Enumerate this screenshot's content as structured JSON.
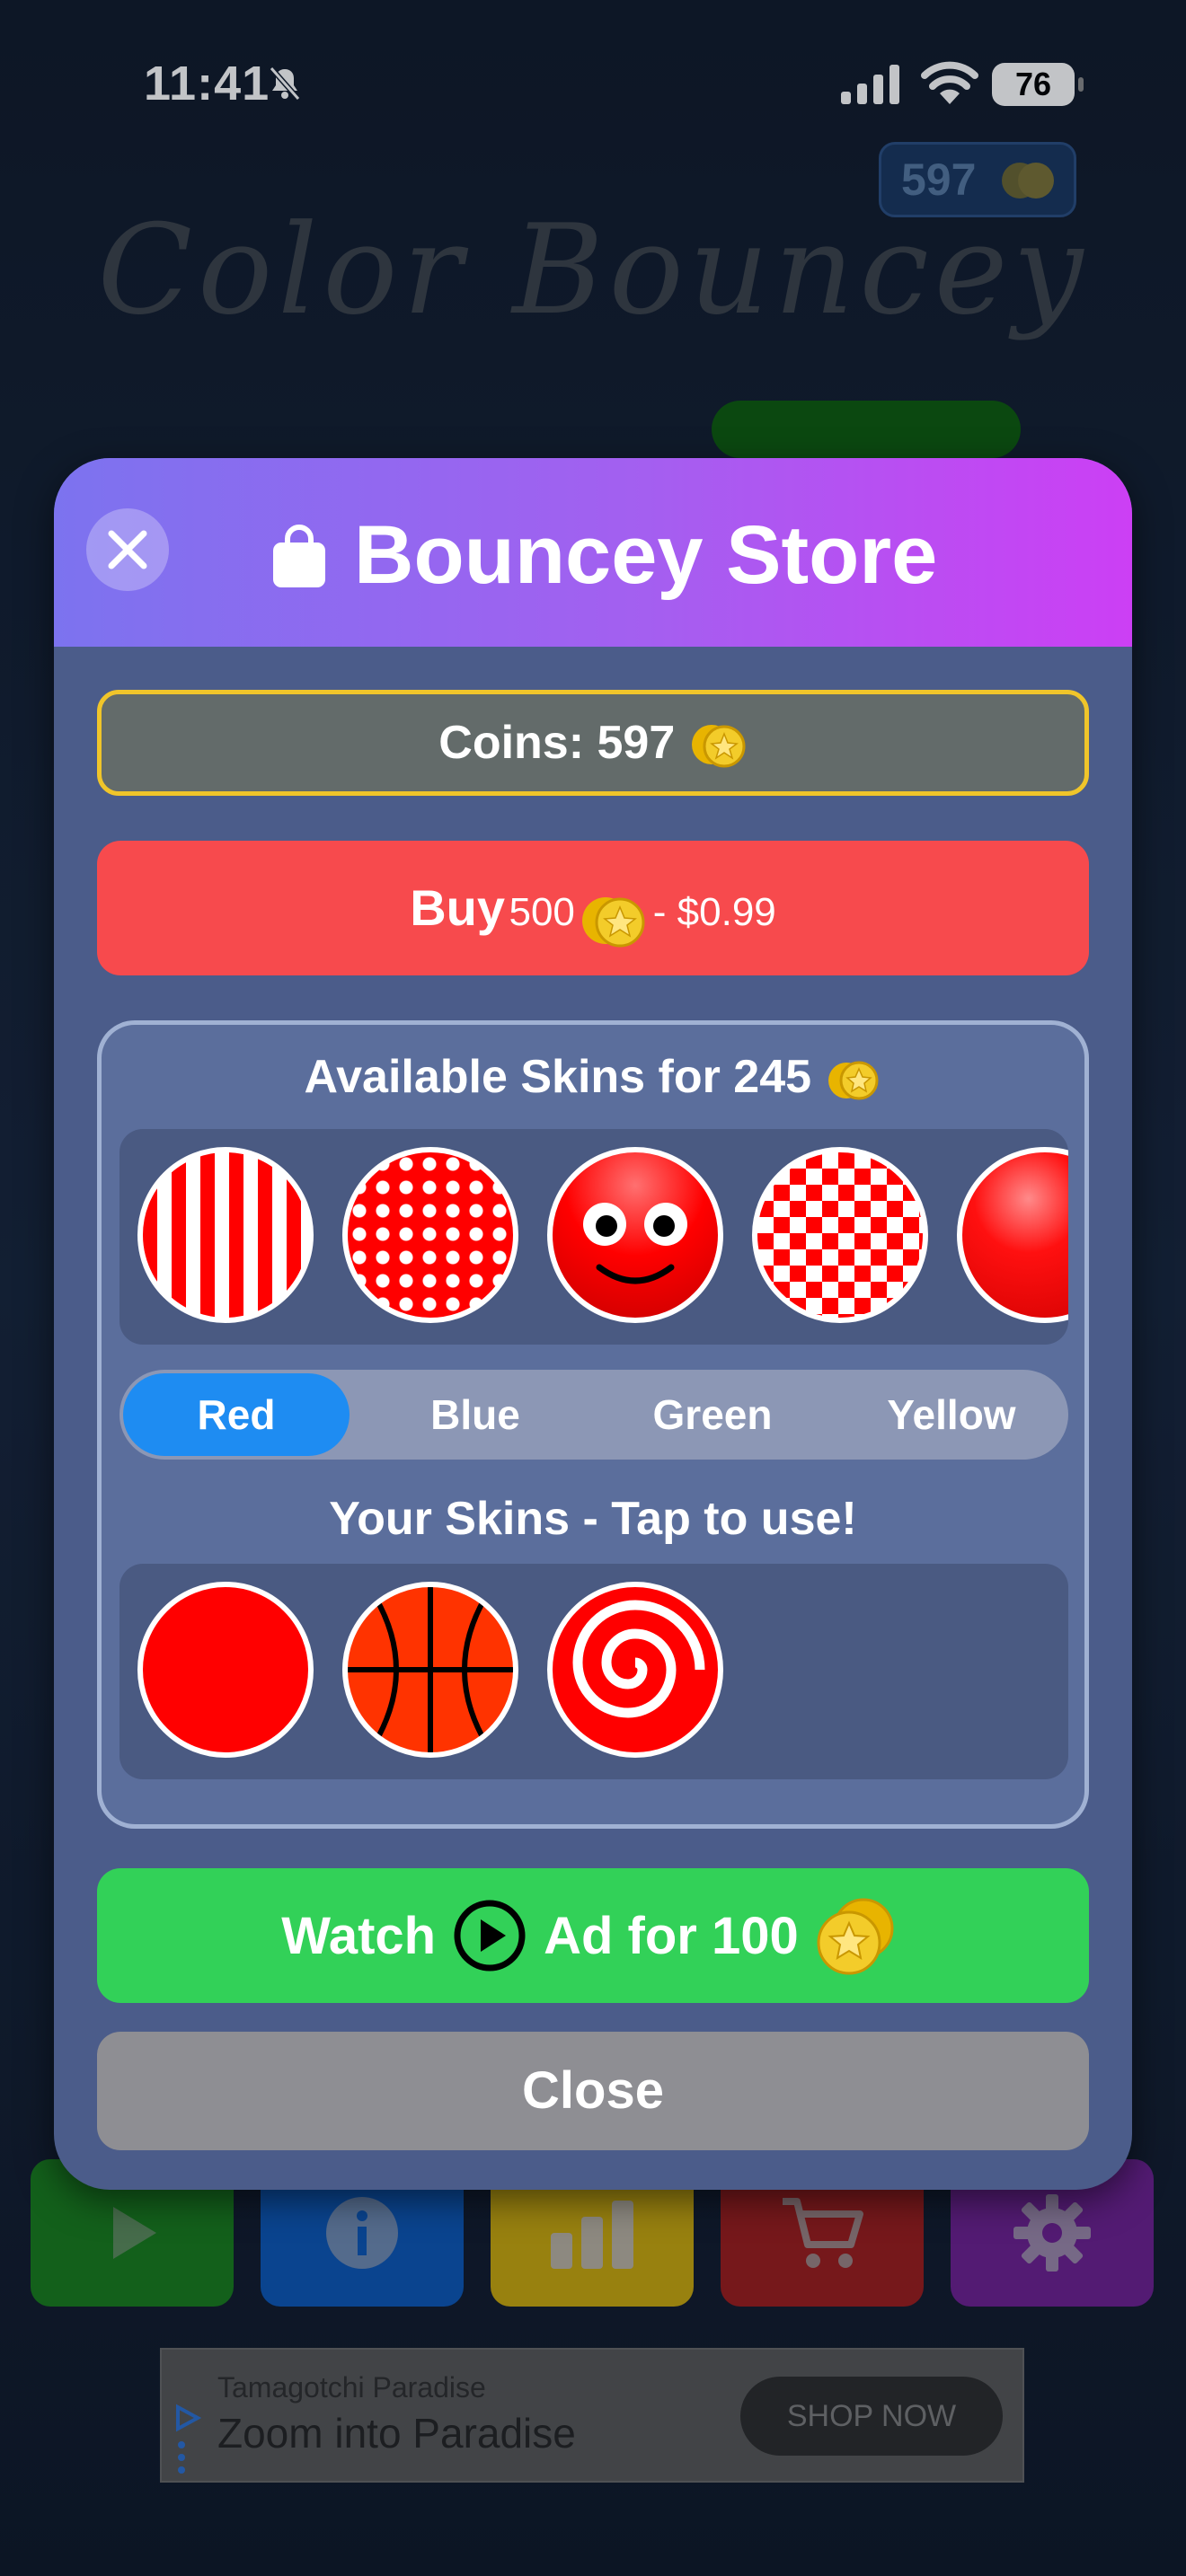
{
  "status_bar": {
    "time": "11:41",
    "battery": "76"
  },
  "game": {
    "coin_badge": "597",
    "title": "Color Bouncey"
  },
  "bottom_bar": {
    "buttons": [
      "play-icon",
      "info-icon",
      "stats-icon",
      "cart-icon",
      "gear-icon"
    ],
    "colors": [
      "#167a1a",
      "#0a55b5",
      "#c7a60a",
      "#9a1a1a",
      "#6b1e8f"
    ]
  },
  "ad": {
    "advertiser": "Tamagotchi Paradise",
    "headline": "Zoom into Paradise",
    "cta": "SHOP NOW"
  },
  "store": {
    "title": "Bouncey Store",
    "coins_label": "Coins: 597",
    "buy": {
      "main": "Buy",
      "sub": "500",
      "price": "- $0.99"
    },
    "available_title": "Available Skins for 245",
    "available_skins": [
      "stripes-red",
      "polka-dots-red",
      "smiley-face-red",
      "checkerboard-red",
      "glossy-red"
    ],
    "color_tabs": [
      "Red",
      "Blue",
      "Green",
      "Yellow"
    ],
    "selected_color": "Red",
    "your_title": "Your Skins - Tap to use!",
    "owned_skins": [
      "solid-red",
      "basketball",
      "spiral-red"
    ],
    "watch": {
      "pre": "Watch",
      "post": "Ad for 100"
    },
    "close_label": "Close"
  },
  "colors": {
    "header_gradient_start": "#7c73ef",
    "header_gradient_end": "#cc3ff4",
    "buy_red": "#f74a4d",
    "watch_green": "#32d158",
    "tab_active": "#1e8cf2",
    "coin_border": "#f0c52a",
    "skin_red": "#ff0000"
  }
}
